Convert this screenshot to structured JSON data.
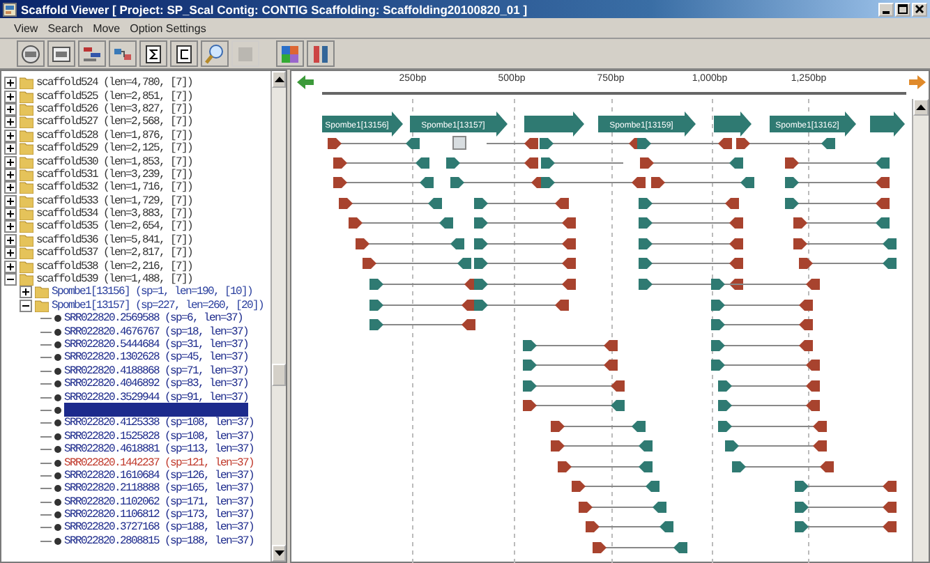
{
  "window": {
    "title": "Scaffold Viewer [ Project: SP_Scal Contig: CONTIG Scaffolding: Scaffolding20100820_01 ]"
  },
  "menu": [
    "View",
    "Search",
    "Move",
    "Option Settings"
  ],
  "toolbar": [
    {
      "kind": "auto",
      "disabled": false
    },
    {
      "kind": "edit",
      "disabled": false
    },
    {
      "kind": "pack",
      "disabled": false
    },
    {
      "kind": "link",
      "disabled": false
    },
    {
      "kind": "sigma",
      "disabled": false
    },
    {
      "kind": "contig",
      "disabled": false
    },
    {
      "kind": "zoom",
      "disabled": false
    },
    {
      "kind": "blank",
      "disabled": true
    },
    {
      "kind": "palette",
      "disabled": false
    },
    {
      "kind": "swap",
      "disabled": false
    }
  ],
  "tree": [
    {
      "label": "scaffold524 (len=4,780, [7])",
      "expanded": false
    },
    {
      "label": "scaffold525 (len=2,851, [7])",
      "expanded": false
    },
    {
      "label": "scaffold526 (len=3,827, [7])",
      "expanded": false
    },
    {
      "label": "scaffold527 (len=2,568, [7])",
      "expanded": false
    },
    {
      "label": "scaffold528 (len=1,876, [7])",
      "expanded": false
    },
    {
      "label": "scaffold529 (len=2,125, [7])",
      "expanded": false
    },
    {
      "label": "scaffold530 (len=1,853, [7])",
      "expanded": false
    },
    {
      "label": "scaffold531 (len=3,239, [7])",
      "expanded": false
    },
    {
      "label": "scaffold532 (len=1,716, [7])",
      "expanded": false
    },
    {
      "label": "scaffold533 (len=1,729, [7])",
      "expanded": false
    },
    {
      "label": "scaffold534 (len=3,883, [7])",
      "expanded": false
    },
    {
      "label": "scaffold535 (len=2,654, [7])",
      "expanded": false
    },
    {
      "label": "scaffold536 (len=5,841, [7])",
      "expanded": false
    },
    {
      "label": "scaffold537 (len=2,817, [7])",
      "expanded": false
    },
    {
      "label": "scaffold538 (len=2,216, [7])",
      "expanded": false
    },
    {
      "label": "scaffold539 (len=1,488, [7])",
      "expanded": true,
      "children": [
        {
          "label": "Spombe1[13156] (sp=1, len=190, [10])",
          "expanded": false
        },
        {
          "label": "Spombe1[13157] (sp=227, len=260, [20])",
          "expanded": true,
          "children": [
            {
              "label": "SRR022820.2569588 (sp=6, len=37)",
              "selected": false,
              "color": "#1c2a8c"
            },
            {
              "label": "SRR022820.4676767 (sp=18, len=37)",
              "selected": false,
              "color": "#1c2a8c"
            },
            {
              "label": "SRR022820.5444684 (sp=31, len=37)",
              "selected": false,
              "color": "#1c2a8c"
            },
            {
              "label": "SRR022820.1302628 (sp=45, len=37)",
              "selected": false,
              "color": "#1c2a8c"
            },
            {
              "label": "SRR022820.4188868 (sp=71, len=37)",
              "selected": false,
              "color": "#1c2a8c"
            },
            {
              "label": "SRR022820.4046892 (sp=83, len=37)",
              "selected": false,
              "color": "#1c2a8c"
            },
            {
              "label": "SRR022820.3529944 (sp=91, len=37)",
              "selected": false,
              "color": "#1c2a8c"
            },
            {
              "selected": true,
              "color": "#1c2a8c"
            },
            {
              "label": "SRR022820.4125338 (sp=108, len=37)",
              "selected": false,
              "color": "#1c2a8c"
            },
            {
              "label": "SRR022820.1525828 (sp=108, len=37)",
              "selected": false,
              "color": "#1c2a8c"
            },
            {
              "label": "SRR022820.4618881 (sp=113, len=37)",
              "selected": false,
              "color": "#1c2a8c"
            },
            {
              "label": "SRR022820.1442237 (sp=121, len=37)",
              "selected": false,
              "color": "#c0392b"
            },
            {
              "label": "SRR022820.1610684 (sp=126, len=37)",
              "selected": false,
              "color": "#1c2a8c"
            },
            {
              "label": "SRR022820.2118888 (sp=165, len=37)",
              "selected": false,
              "color": "#1c2a8c"
            },
            {
              "label": "SRR022820.1102062 (sp=171, len=37)",
              "selected": false,
              "color": "#1c2a8c"
            },
            {
              "label": "SRR022820.1106812 (sp=173, len=37)",
              "selected": false,
              "color": "#1c2a8c"
            },
            {
              "label": "SRR022820.3727168 (sp=188, len=37)",
              "selected": false,
              "color": "#1c2a8c"
            },
            {
              "label": "SRR022820.2808815 (sp=188, len=37)",
              "selected": false,
              "color": "#1c2a8c"
            }
          ]
        }
      ]
    }
  ],
  "ruler": {
    "ticks": [
      "250bp",
      "500bp",
      "750bp",
      "1,000bp",
      "1,250bp"
    ]
  },
  "contigs": [
    {
      "kind": "labeled",
      "label": "Spombe1[13156]"
    },
    {
      "kind": "labeled",
      "label": "Spombe1[13157]"
    },
    {
      "kind": "unlabeled"
    },
    {
      "kind": "labeled",
      "label": "Spombe1[13159]"
    },
    {
      "kind": "unlabeled"
    },
    {
      "kind": "labeled",
      "label": "Spombe1[13162]"
    },
    {
      "kind": "unlabeled"
    }
  ]
}
